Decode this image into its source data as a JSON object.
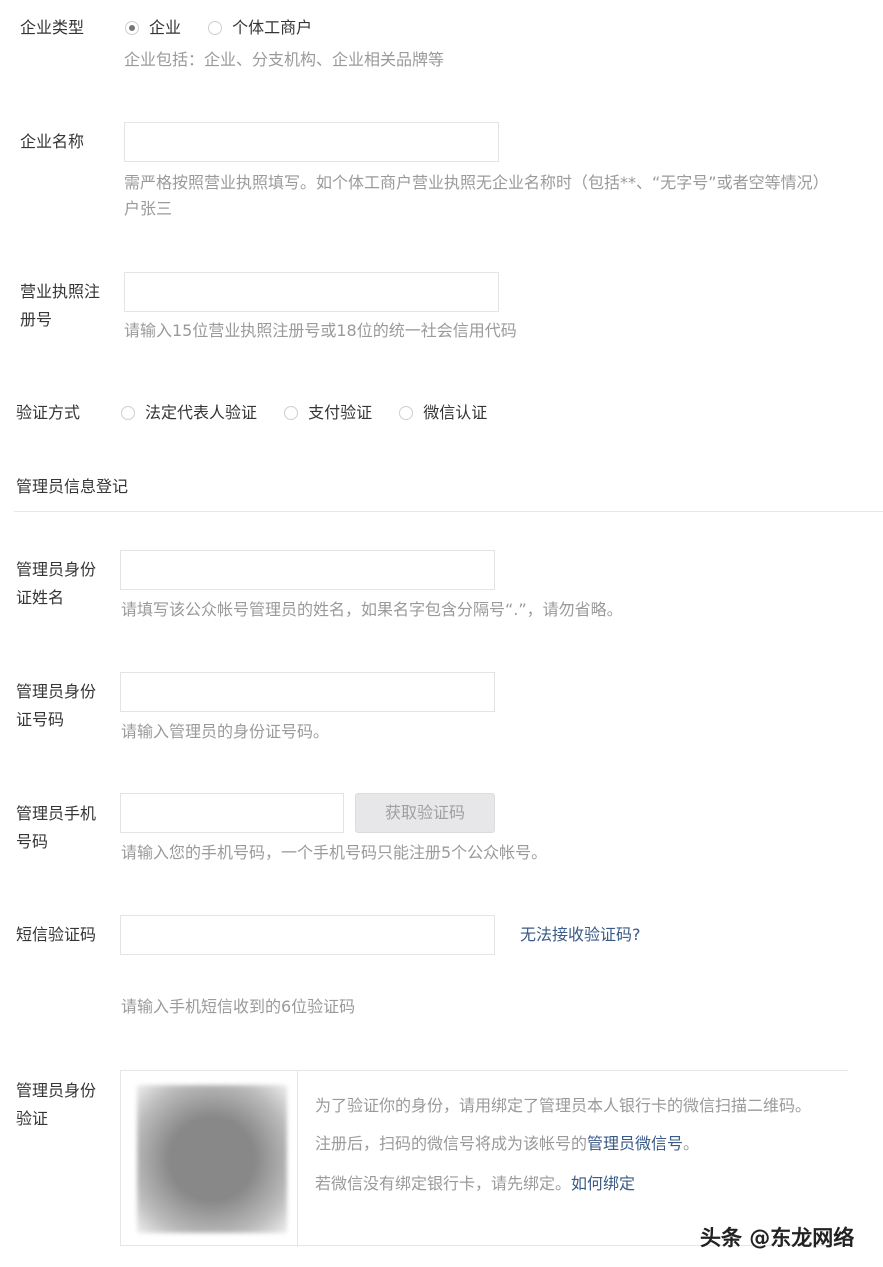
{
  "company_type": {
    "label": "企业类型",
    "options": [
      "企业",
      "个体工商户"
    ],
    "selected": 0,
    "tip": "企业包括：企业、分支机构、企业相关品牌等"
  },
  "company_name": {
    "label": "企业名称",
    "value": "",
    "tip": "需严格按照营业执照填写。如个体工商户营业执照无企业名称时（包括**、“无字号”或者空等情况）",
    "tip2": "户张三"
  },
  "license": {
    "label": "营业执照注册号",
    "value": "",
    "tip": "请输入15位营业执照注册号或18位的统一社会信用代码"
  },
  "verify": {
    "label": "验证方式",
    "options": [
      "法定代表人验证",
      "支付验证",
      "微信认证"
    ]
  },
  "section_title": "管理员信息登记",
  "admin_name": {
    "label": "管理员身份证姓名",
    "value": "",
    "tip": "请填写该公众帐号管理员的姓名，如果名字包含分隔号“.”，请勿省略。"
  },
  "admin_id": {
    "label": "管理员身份证号码",
    "value": "",
    "tip": "请输入管理员的身份证号码。"
  },
  "admin_phone": {
    "label": "管理员手机号码",
    "value": "",
    "button": "获取验证码",
    "tip": "请输入您的手机号码，一个手机号码只能注册5个公众帐号。"
  },
  "sms": {
    "label": "短信验证码",
    "value": "",
    "link": "无法接收验证码?",
    "tip": "请输入手机短信收到的6位验证码"
  },
  "admin_verify": {
    "label": "管理员身份验证",
    "line1": "为了验证你的身份，请用绑定了管理员本人银行卡的微信扫描二维码。",
    "line2a": "注册后，扫码的微信号将成为该帐号的",
    "line2b": "管理员微信号",
    "line2c": "。",
    "line3a": "若微信没有绑定银行卡，请先绑定。",
    "line3b": "如何绑定"
  },
  "watermark": "头条 @东龙网络"
}
